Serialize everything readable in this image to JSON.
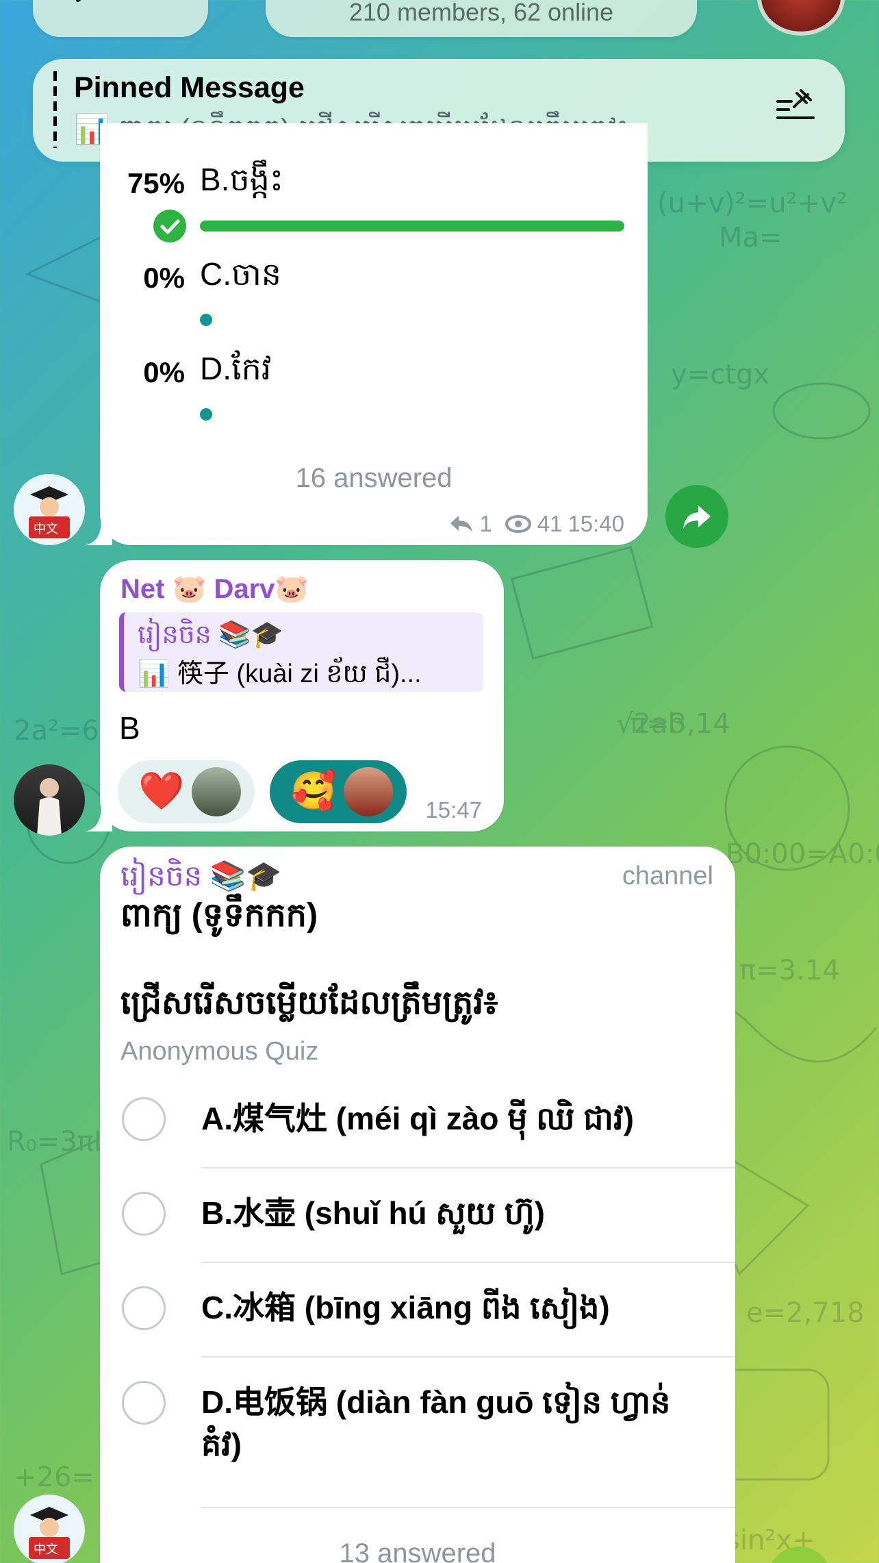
{
  "header": {
    "members_status": "210 members, 62 online"
  },
  "pinned": {
    "title": "Pinned Message",
    "text": "📊 ពាក្យ (ទូទឹកកក) ជ្រើសរើសចម្លើយដែលត្រឹមត្រូវ៖"
  },
  "poll_result": {
    "rows": [
      {
        "pct": "75%",
        "label": "B.ចង្កឹះ",
        "fill": 1.0,
        "chosen": true
      },
      {
        "pct": "0%",
        "label": "C.ចាន",
        "fill": 0.0
      },
      {
        "pct": "0%",
        "label": "D.កែវ",
        "fill": 0.0
      }
    ],
    "answered": "16 answered",
    "replies": "1",
    "views": "41",
    "time": "15:40"
  },
  "reply_msg": {
    "sender": "Net 🐷 Darv🐷",
    "quote_source": "រៀនចិន 📚🎓",
    "quote_text": "📊 筷子 (kuài zi ខ័យ ជឺ)...",
    "body": "B",
    "reactions": [
      {
        "emoji": "❤️",
        "style": "light"
      },
      {
        "emoji": "🥰",
        "style": "dark"
      }
    ],
    "time": "15:47"
  },
  "quiz": {
    "source": "រៀនចិន 📚🎓",
    "tag": "channel",
    "line1": "ពាក្យ (ទូទឹកកក)",
    "line2": "ជ្រើសរើសចម្លើយដែលត្រឹមត្រូវ៖",
    "kind": "Anonymous Quiz",
    "options": [
      "A.煤气灶 (méi qì zào ម៉ី ឈិ ជាវ)",
      "B.水壶 (shuǐ hú សួយ ហ៊ូ)",
      "C.冰箱 (bīng xiāng ពីង សៀង)",
      "D.电饭锅 (diàn fàn guō ទៀន ហ្វាន់ គំវ)"
    ],
    "answered": "13 answered"
  },
  "colors": {
    "accent_green": "#2db33f",
    "teal": "#14958f",
    "purple": "#8f4fd6"
  }
}
